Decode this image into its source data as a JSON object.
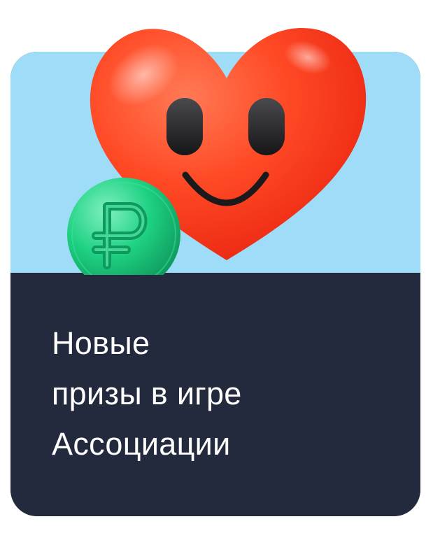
{
  "banner": {
    "headline_lines": [
      "Новые",
      "призы в игре",
      "Ассоциации"
    ],
    "colors": {
      "sky": "#9fdcf8",
      "panel": "#232a3d",
      "heart": "#ff3d1f",
      "coin": "#1ccf7c",
      "text": "#ffffff"
    },
    "icons": {
      "heart": "smiling-heart-icon",
      "coin": "ruble-coin-icon"
    }
  }
}
